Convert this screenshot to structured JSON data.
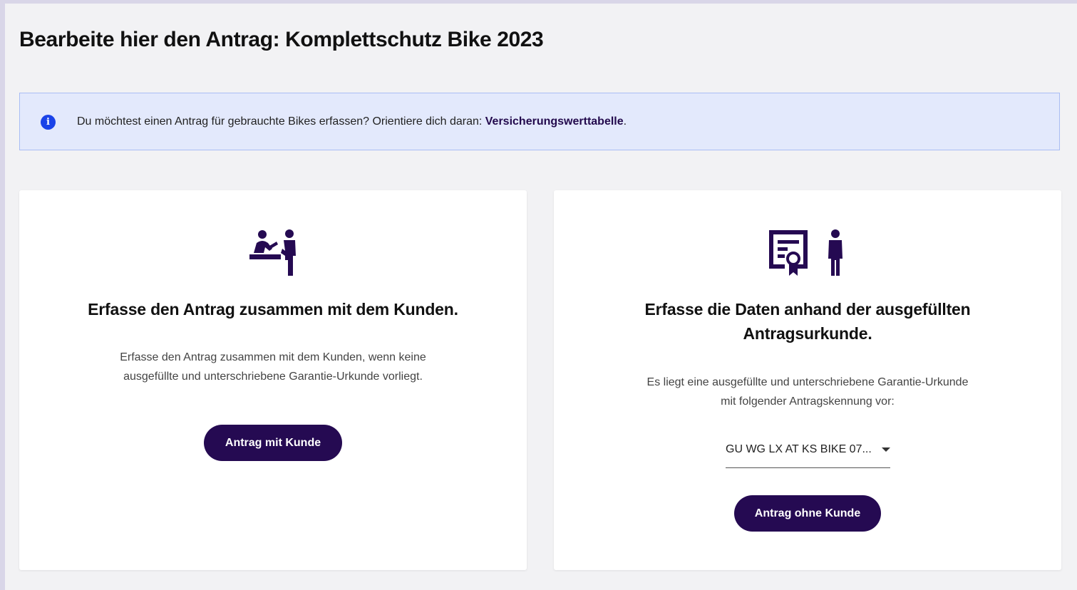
{
  "page": {
    "title": "Bearbeite hier den Antrag: Komplettschutz Bike 2023"
  },
  "info_banner": {
    "icon": "info-icon",
    "text": "Du möchtest einen Antrag für gebrauchte Bikes erfassen? Orientiere dich daran: ",
    "link_label": "Versicherungswerttabelle",
    "trailing": "."
  },
  "card_with_customer": {
    "icon": "customer-consultation-icon",
    "title": "Erfasse den Antrag zusammen mit dem Kunden.",
    "description": "Erfasse den Antrag zusammen mit dem Kunden, wenn keine ausgefüllte und unterschriebene Garantie-Urkunde vorliegt.",
    "button_label": "Antrag mit Kunde"
  },
  "card_without_customer": {
    "icon": "certificate-person-icon",
    "title": "Erfasse die Daten anhand der ausgefüllten Antragsurkunde.",
    "description": "Es liegt eine ausgefüllte und unterschriebene Garantie-Urkunde mit folgender Antragskennung vor:",
    "select_value": "GU WG LX AT KS BIKE 07...",
    "button_label": "Antrag ohne Kunde"
  },
  "colors": {
    "primary": "#250a52",
    "banner_bg": "#e3e9fc",
    "banner_border": "#a9bdf4",
    "info_blue": "#1a43e8",
    "page_bg": "#f2f2f4"
  }
}
